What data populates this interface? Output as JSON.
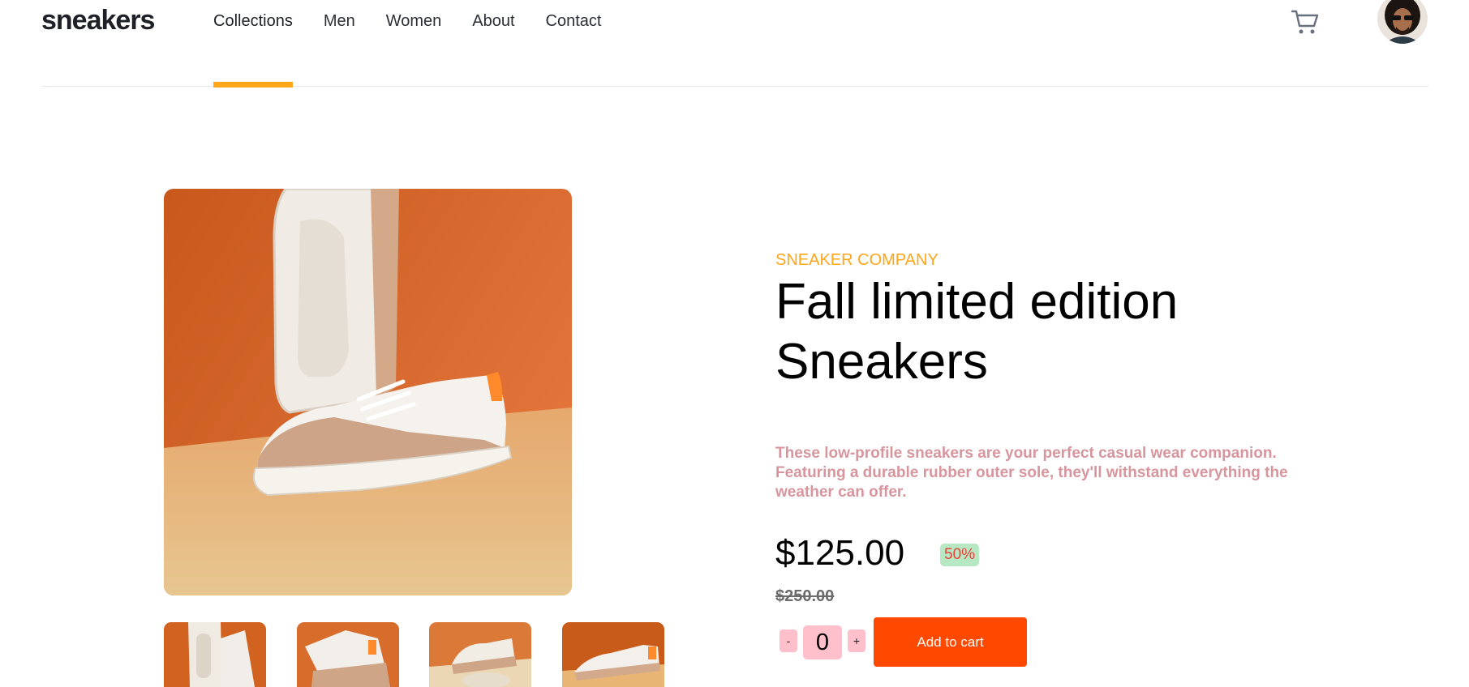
{
  "header": {
    "logo": "sneakers",
    "nav": [
      {
        "label": "Collections",
        "active": true
      },
      {
        "label": "Men",
        "active": false
      },
      {
        "label": "Women",
        "active": false
      },
      {
        "label": "About",
        "active": false
      },
      {
        "label": "Contact",
        "active": false
      }
    ],
    "cart_icon": "cart-icon",
    "avatar": "user-avatar"
  },
  "product": {
    "company": "SNEAKER COMPANY",
    "title": "Fall limited edition Sneakers",
    "description": "These low-profile sneakers are your perfect casual wear companion. Featuring a durable rubber outer sole, they'll withstand everything the weather can offer.",
    "price": "$125.00",
    "discount": "50%",
    "old_price": "$250.00",
    "quantity": "0",
    "minus_label": "-",
    "plus_label": "+",
    "add_to_cart_label": "Add to cart"
  },
  "colors": {
    "accent_orange": "#ffa61a",
    "button_orange": "#ff4800",
    "description_pink": "#d7959e",
    "qty_pink": "#ffc0cb",
    "discount_bg": "#b7e8c4",
    "discount_text": "#e8443b"
  },
  "gallery": {
    "thumbnails": [
      "product-thumbnail-1",
      "product-thumbnail-2",
      "product-thumbnail-3",
      "product-thumbnail-4"
    ]
  }
}
